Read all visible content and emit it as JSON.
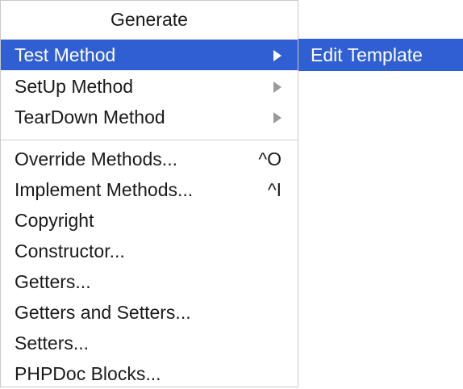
{
  "menu": {
    "title": "Generate",
    "items": [
      {
        "label": "Test Method",
        "submenu": true,
        "selected": true
      },
      {
        "label": "SetUp Method",
        "submenu": true
      },
      {
        "label": "TearDown Method",
        "submenu": true
      },
      {
        "label": "Override Methods...",
        "shortcut": "^O"
      },
      {
        "label": "Implement Methods...",
        "shortcut": "^I"
      },
      {
        "label": "Copyright"
      },
      {
        "label": "Constructor..."
      },
      {
        "label": "Getters..."
      },
      {
        "label": "Getters and Setters..."
      },
      {
        "label": "Setters..."
      },
      {
        "label": "PHPDoc Blocks..."
      }
    ]
  },
  "submenu": {
    "items": [
      {
        "label": "Edit Template",
        "selected": true
      }
    ]
  },
  "colors": {
    "selection": "#2f5fd3",
    "text": "#1a1a1a",
    "arrow": "#9a9a9a"
  },
  "icons": {
    "submenu_arrow": "triangle-right-icon"
  }
}
